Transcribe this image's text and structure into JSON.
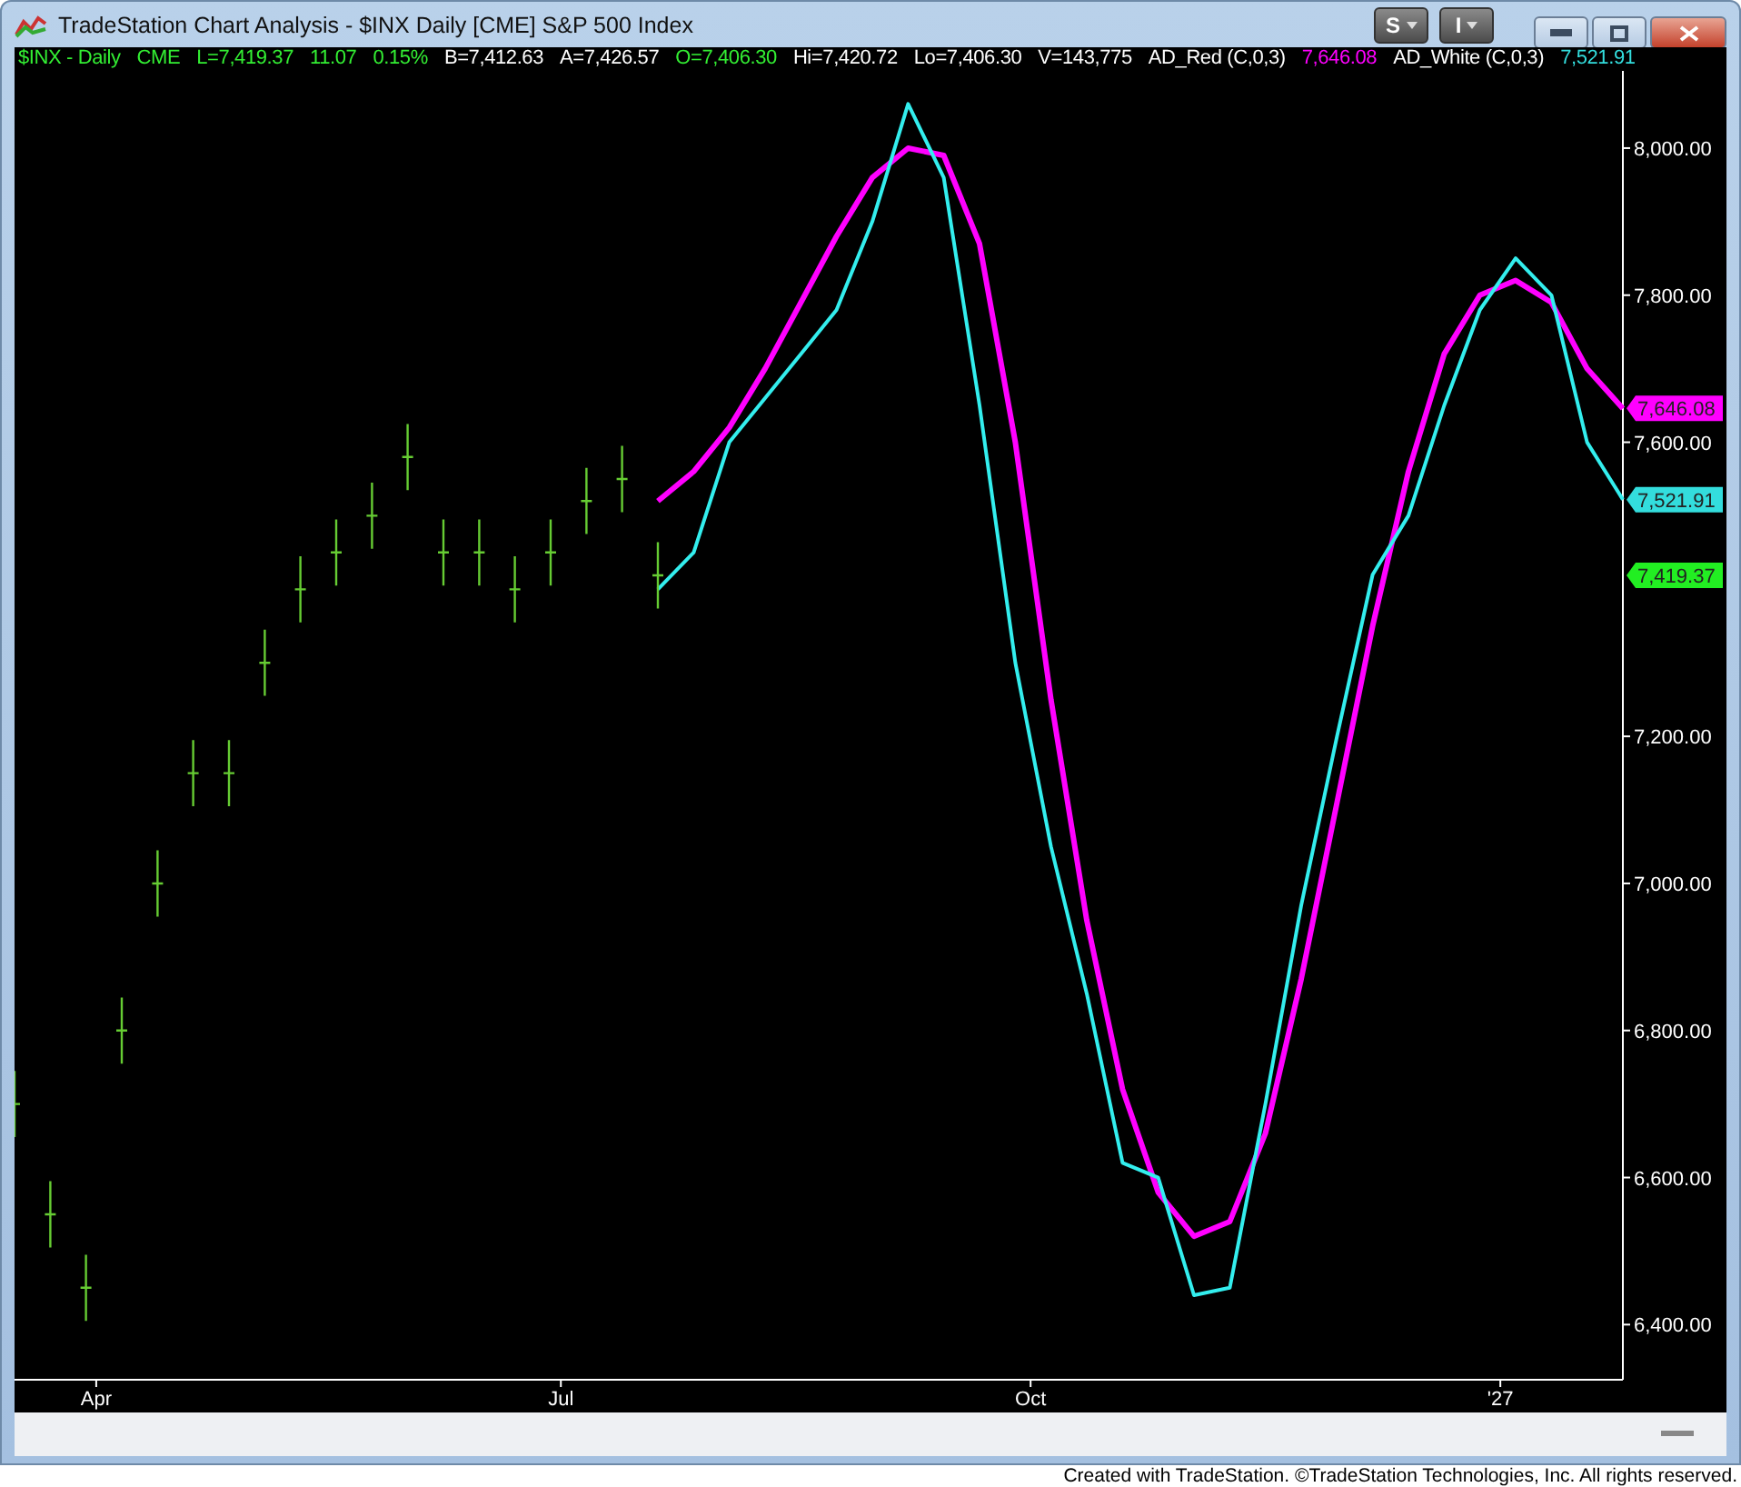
{
  "window": {
    "title": "TradeStation Chart Analysis - $INX Daily [CME] S&P 500 Index",
    "toolbar_buttons": [
      "S",
      "I"
    ]
  },
  "header": [
    {
      "text": "$INX - Daily",
      "color": "#33ee33"
    },
    {
      "text": "CME",
      "color": "#33ee33"
    },
    {
      "text": "L=7,419.37",
      "color": "#33ee33"
    },
    {
      "text": "11.07",
      "color": "#33ee33"
    },
    {
      "text": "0.15%",
      "color": "#33ee33"
    },
    {
      "text": "B=7,412.63",
      "color": "#ffffff"
    },
    {
      "text": "A=7,426.57",
      "color": "#ffffff"
    },
    {
      "text": "O=7,406.30",
      "color": "#33ee33"
    },
    {
      "text": "Hi=7,420.72",
      "color": "#ffffff"
    },
    {
      "text": "Lo=7,406.30",
      "color": "#ffffff"
    },
    {
      "text": "V=143,775",
      "color": "#ffffff"
    },
    {
      "text": "AD_Red (C,0,3)",
      "color": "#ffffff"
    },
    {
      "text": "7,646.08",
      "color": "#ff00ff"
    },
    {
      "text": "AD_White (C,0,3)",
      "color": "#ffffff"
    },
    {
      "text": "7,521.91",
      "color": "#33dddd"
    }
  ],
  "chart_data": {
    "type": "line",
    "x": [
      "2026-07-20",
      "2026-07-27",
      "2026-08-03",
      "2026-08-10",
      "2026-08-17",
      "2026-08-24",
      "2026-08-31",
      "2026-09-07",
      "2026-09-14",
      "2026-09-21",
      "2026-09-28",
      "2026-10-05",
      "2026-10-12",
      "2026-10-19",
      "2026-10-26",
      "2026-11-02",
      "2026-11-09",
      "2026-11-16",
      "2026-11-23",
      "2026-11-30",
      "2026-12-07",
      "2026-12-14",
      "2026-12-21",
      "2026-12-28",
      "2027-01-04",
      "2027-01-11",
      "2027-01-18",
      "2027-01-25"
    ],
    "xlim": [
      "2026-03-16",
      "2027-01-25"
    ],
    "ylim": [
      6325,
      8105
    ],
    "xticks": [
      {
        "value": "2026-04-01",
        "label": "Apr"
      },
      {
        "value": "2026-07-01",
        "label": "Jul"
      },
      {
        "value": "2026-10-01",
        "label": "Oct"
      },
      {
        "value": "2027-01-01",
        "label": "'27"
      }
    ],
    "yticks": [
      {
        "value": 6400,
        "label": "6,400.00"
      },
      {
        "value": 6600,
        "label": "6,600.00"
      },
      {
        "value": 6800,
        "label": "6,800.00"
      },
      {
        "value": 7000,
        "label": "7,000.00"
      },
      {
        "value": 7200,
        "label": "7,200.00"
      },
      {
        "value": 7600,
        "label": "7,600.00"
      },
      {
        "value": 7800,
        "label": "7,800.00"
      },
      {
        "value": 8000,
        "label": "8,000.00"
      }
    ],
    "series": [
      {
        "color": "#ff00ff",
        "values": [
          7520,
          7560,
          7620,
          7700,
          7790,
          7880,
          7960,
          8000,
          7990,
          7870,
          7600,
          7250,
          6950,
          6720,
          6580,
          6520,
          6540,
          6660,
          6870,
          7110,
          7350,
          7560,
          7720,
          7800,
          7820,
          7790,
          7700,
          7646
        ]
      },
      {
        "color": "#33eeee",
        "values": [
          7400,
          7450,
          7600,
          7660,
          7720,
          7780,
          7900,
          8060,
          7960,
          7650,
          7300,
          7050,
          6850,
          6620,
          6600,
          6440,
          6450,
          6700,
          6970,
          7200,
          7420,
          7500,
          7650,
          7780,
          7850,
          7800,
          7600,
          7522
        ]
      }
    ]
  },
  "price_tags": [
    {
      "text": "7,646.08",
      "color": "#ff00ff"
    },
    {
      "text": "7,521.91",
      "color": "#33dddd"
    },
    {
      "text": "7,419.37",
      "color": "#22ee22"
    }
  ],
  "footer": "Created with TradeStation. ©TradeStation Technologies, Inc. All rights reserved."
}
